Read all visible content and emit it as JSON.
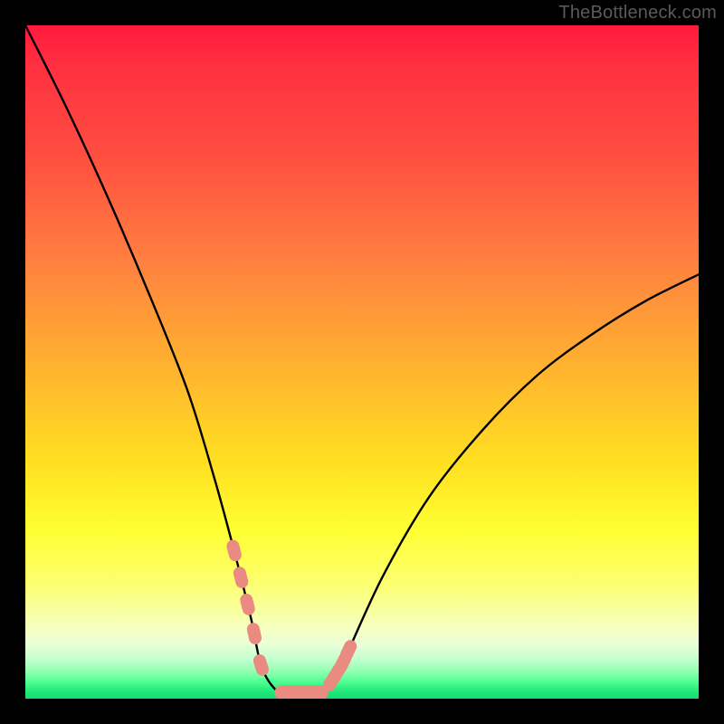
{
  "watermark": "TheBottleneck.com",
  "chart_data": {
    "type": "line",
    "title": "",
    "xlabel": "",
    "ylabel": "",
    "xlim": [
      0,
      100
    ],
    "ylim": [
      0,
      100
    ],
    "series": [
      {
        "name": "bottleneck-curve",
        "x": [
          0,
          6,
          12,
          18,
          24,
          28,
          31,
          33.5,
          35,
          37,
          39,
          42,
          45,
          47,
          53,
          60,
          68,
          76,
          84,
          92,
          100
        ],
        "values": [
          100,
          88,
          75,
          61,
          46,
          33,
          22,
          12,
          5,
          1.5,
          0.8,
          0.8,
          1.8,
          5,
          18,
          30,
          40,
          48,
          54,
          59,
          63
        ]
      }
    ],
    "markers": {
      "left_cluster": {
        "x_range": [
          31,
          35
        ],
        "y_range": [
          5,
          22
        ]
      },
      "right_cluster": {
        "x_range": [
          45.5,
          48
        ],
        "y_range": [
          3,
          8
        ]
      },
      "bottom_bar": {
        "x_range": [
          37,
          45
        ],
        "y": 0.9
      }
    },
    "gradient_stops": [
      {
        "pos": 0,
        "meaning": "worst",
        "color": "#ff1a3c"
      },
      {
        "pos": 0.75,
        "meaning": "mid",
        "color": "#ffff33"
      },
      {
        "pos": 1.0,
        "meaning": "best",
        "color": "#17d877"
      }
    ]
  }
}
